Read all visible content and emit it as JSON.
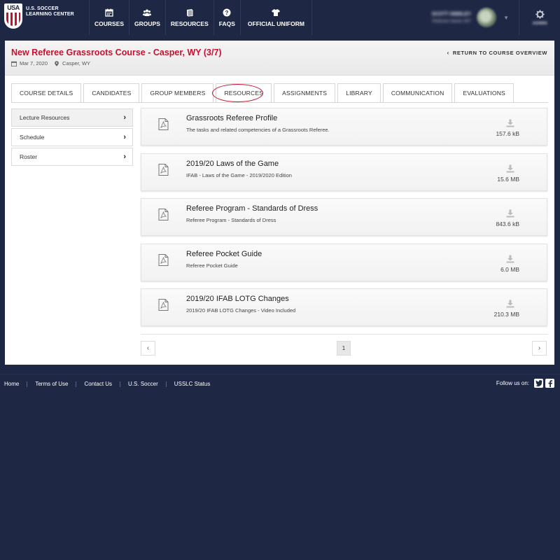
{
  "brand": {
    "mark": "USA",
    "name_line1": "U.S. SOCCER",
    "name_line2": "LEARNING CENTER"
  },
  "nav": {
    "items": [
      {
        "label": "COURSES",
        "icon": "calendar-icon"
      },
      {
        "label": "GROUPS",
        "icon": "users-icon"
      },
      {
        "label": "RESOURCES",
        "icon": "book-icon"
      },
      {
        "label": "FAQS",
        "icon": "question-icon"
      },
      {
        "label": "OFFICIAL UNIFORM",
        "icon": "shirt-icon"
      }
    ]
  },
  "user": {
    "name": "SCOTT HIBBLEY",
    "subtitle": "Referee Admin WY",
    "settings_label": "ADMIN"
  },
  "course": {
    "title": "New Referee Grassroots Course - Casper, WY (3/7)",
    "date": "Mar 7, 2020",
    "location": "Casper, WY",
    "return_label": "RETURN TO COURSE OVERVIEW"
  },
  "tabs": [
    {
      "label": "COURSE DETAILS"
    },
    {
      "label": "CANDIDATES"
    },
    {
      "label": "GROUP MEMBERS"
    },
    {
      "label": "RESOURCES",
      "active": true
    },
    {
      "label": "ASSIGNMENTS"
    },
    {
      "label": "LIBRARY"
    },
    {
      "label": "COMMUNICATION"
    },
    {
      "label": "EVALUATIONS"
    }
  ],
  "sidebar": {
    "items": [
      {
        "label": "Lecture Resources",
        "active": true
      },
      {
        "label": "Schedule"
      },
      {
        "label": "Roster"
      }
    ]
  },
  "resources": [
    {
      "title": "Grassroots Referee Profile",
      "description": "The tasks and related competencies of a Grassroots Referee.",
      "size": "157.6 kB",
      "icon": "pdf-icon"
    },
    {
      "title": "2019/20 Laws of the Game",
      "description": "IFAB - Laws of the Game - 2019/2020 Edition",
      "size": "15.6 MB",
      "icon": "pdf-icon"
    },
    {
      "title": "Referee Program - Standards of Dress",
      "description": "Referee Program - Standards of Dress",
      "size": "843.6 kB",
      "icon": "pdf-icon"
    },
    {
      "title": "Referee Pocket Guide",
      "description": "Referee Pocket Guide",
      "size": "6.0 MB",
      "icon": "pdf-icon"
    },
    {
      "title": "2019/20 IFAB LOTG Changes",
      "description": "2019/20 IFAB LOTG Changes - Video Included",
      "size": "210.3 MB",
      "icon": "pdf-icon"
    }
  ],
  "pagination": {
    "current_page": "1",
    "prev": "‹",
    "next": "›"
  },
  "footer": {
    "links": [
      "Home",
      "Terms of Use",
      "Contact Us",
      "U.S. Soccer",
      "USSLC Status"
    ],
    "follow_label": "Follow us on:",
    "social": [
      "twitter-icon",
      "facebook-icon"
    ]
  },
  "colors": {
    "navy": "#1e2744",
    "accent_red": "#c8102e"
  }
}
